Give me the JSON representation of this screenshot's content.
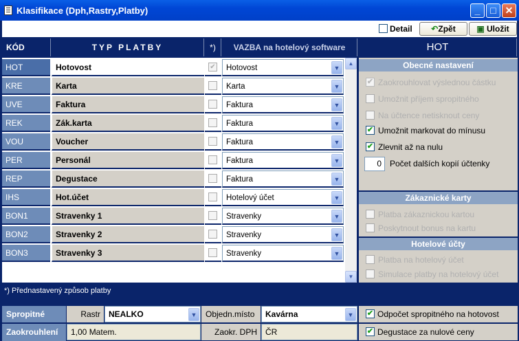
{
  "window": {
    "title": "Klasifikace (Dph,Rastry,Platby)"
  },
  "toolbar": {
    "detail_label": "Detail",
    "back_label": "Zpět",
    "save_label": "Uložit"
  },
  "columns": {
    "kod": "KÓD",
    "typ": "TYP PLATBY",
    "chk": "*)",
    "vazba": "VAZBA na hotelový software",
    "hot": "HOT"
  },
  "rows": [
    {
      "kod": "HOT",
      "typ": "Hotovost",
      "checked": true,
      "vazba": "Hotovost",
      "selected": true
    },
    {
      "kod": "KRE",
      "typ": "Karta",
      "checked": false,
      "vazba": "Karta"
    },
    {
      "kod": "UVE",
      "typ": "Faktura",
      "checked": false,
      "vazba": "Faktura"
    },
    {
      "kod": "REK",
      "typ": "Zák.karta",
      "checked": false,
      "vazba": "Faktura"
    },
    {
      "kod": "VOU",
      "typ": "Voucher",
      "checked": false,
      "vazba": "Faktura"
    },
    {
      "kod": "PER",
      "typ": "Personál",
      "checked": false,
      "vazba": "Faktura"
    },
    {
      "kod": "REP",
      "typ": "Degustace",
      "checked": false,
      "vazba": "Faktura"
    },
    {
      "kod": "IHS",
      "typ": "Hot.účet",
      "checked": false,
      "vazba": "Hotelový účet"
    },
    {
      "kod": "BON1",
      "typ": "Stravenky 1",
      "checked": false,
      "vazba": "Stravenky"
    },
    {
      "kod": "BON2",
      "typ": "Stravenky 2",
      "checked": false,
      "vazba": "Stravenky"
    },
    {
      "kod": "BON3",
      "typ": "Stravenky 3",
      "checked": false,
      "vazba": "Stravenky"
    }
  ],
  "general": {
    "title": "Obecné nastavení",
    "opt1": "Zaokrouhlovat výslednou částku",
    "opt2": "Umožnit příjem spropitného",
    "opt3": "Na účtence netisknout ceny",
    "opt4": "Umožnit markovat do mínusu",
    "opt5": "Zlevnit až na nulu",
    "copies_value": "0",
    "copies_label": "Počet dalších kopií účtenky"
  },
  "cards": {
    "title": "Zákaznické karty",
    "opt1": "Platba zákaznickou kartou",
    "opt2": "Poskytnout bonus na kartu"
  },
  "hotel": {
    "title": "Hotelové účty",
    "opt1": "Platba na hotelový účet",
    "opt2": "Simulace platby na hotelový účet"
  },
  "footnote": "*) Přednastavený způsob platby",
  "footer": {
    "tip_label": "Spropitné",
    "rastr_label": "Rastr",
    "rastr_value": "NEALKO",
    "place_label": "Objedn.místo",
    "place_value": "Kavárna",
    "tip_option": "Odpočet spropitného na hotovost",
    "round_label": "Zaokrouhlení",
    "round_value": "1,00  Matem.",
    "vat_label": "Zaokr. DPH",
    "vat_value": "ČR",
    "degust_option": "Degustace za nulové ceny"
  }
}
